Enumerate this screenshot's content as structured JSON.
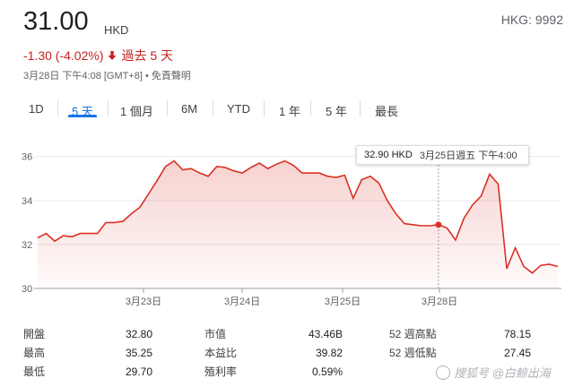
{
  "quote": {
    "price": "31.00",
    "currency": "HKD",
    "ticker": "HKG: 9992",
    "change": "-1.30 (-4.02%)",
    "period": "過去 5 天",
    "timestamp": "3月28日 下午4:08 [GMT+8] • 免責聲明",
    "down_color": "#c5221f"
  },
  "tabs": [
    {
      "label": "1D"
    },
    {
      "label": "5 天",
      "active": true
    },
    {
      "label": "1 個月"
    },
    {
      "label": "6M"
    },
    {
      "label": "YTD"
    },
    {
      "label": "1 年"
    },
    {
      "label": "5 年"
    },
    {
      "label": "最長"
    }
  ],
  "tooltip": {
    "value": "32.90 HKD",
    "date": "3月25日週五 下午4:00"
  },
  "chart_data": {
    "type": "area",
    "line_color": "#d93025",
    "ylim": [
      30,
      36.6
    ],
    "yticks": [
      "36",
      "34",
      "32",
      "30"
    ],
    "xticks": [
      "3月23日",
      "3月24日",
      "3月25日",
      "3月28日"
    ],
    "grid": true,
    "highlight_index": 47,
    "series": [
      {
        "values": [
          32.3,
          32.5,
          32.15,
          32.4,
          32.35,
          32.5,
          32.5,
          32.5,
          33.0,
          33.0,
          33.05,
          33.4,
          33.7,
          34.3,
          34.9,
          35.55,
          35.8,
          35.4,
          35.45,
          35.25,
          35.1,
          35.55,
          35.5,
          35.35,
          35.25,
          35.5,
          35.7,
          35.45,
          35.65,
          35.8,
          35.6,
          35.25,
          35.25,
          35.25,
          35.1,
          35.05,
          35.15,
          34.1,
          34.95,
          35.1,
          34.8,
          34.0,
          33.4,
          32.95,
          32.9,
          32.85,
          32.85,
          32.9,
          32.75,
          32.2,
          33.2,
          33.8,
          34.2,
          35.2,
          34.75,
          30.9,
          31.85,
          31.0,
          30.7,
          31.05,
          31.1,
          31.0
        ]
      }
    ]
  },
  "stats": {
    "col1": [
      {
        "label": "開盤",
        "value": "32.80"
      },
      {
        "label": "最高",
        "value": "35.25"
      },
      {
        "label": "最低",
        "value": "29.70"
      }
    ],
    "col2": [
      {
        "label": "市值",
        "value": "43.46B"
      },
      {
        "label": "本益比",
        "value": "39.82"
      },
      {
        "label": "殖利率",
        "value": "0.59%"
      }
    ],
    "col3": [
      {
        "label": "52 週高點",
        "value": "78.15"
      },
      {
        "label": "52 週低點",
        "value": "27.45"
      }
    ]
  },
  "watermark": "搜狐号 @白鲸出海"
}
